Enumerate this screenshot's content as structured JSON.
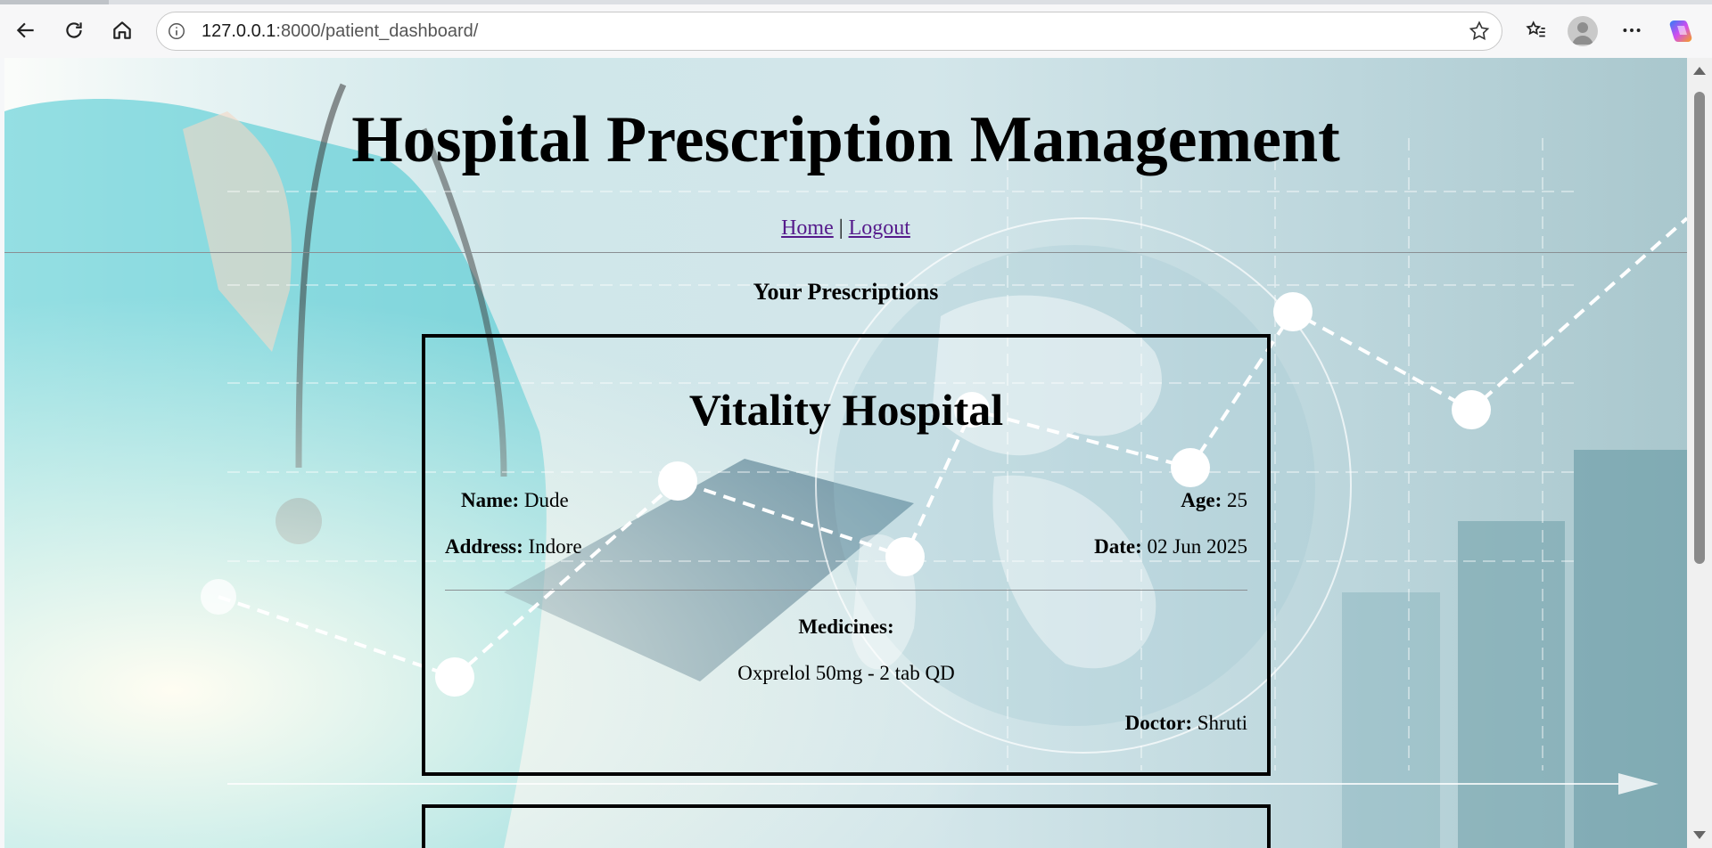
{
  "browser": {
    "url_host": "127.0.0.1",
    "url_path": ":8000/patient_dashboard/"
  },
  "page": {
    "title": "Hospital Prescription Management",
    "nav": {
      "home": "Home",
      "separator": "|",
      "logout": "Logout"
    },
    "section_title": "Your Prescriptions"
  },
  "prescriptions": [
    {
      "hospital": "Vitality Hospital",
      "name_label": "Name:",
      "name": "Dude",
      "age_label": "Age:",
      "age": "25",
      "address_label": "Address:",
      "address": "Indore",
      "date_label": "Date:",
      "date": "02 Jun 2025",
      "medicines_label": "Medicines:",
      "medicines": "Oxprelol 50mg - 2 tab QD",
      "doctor_label": "Doctor:",
      "doctor": "Shruti"
    }
  ],
  "colors": {
    "link": "#551a8b",
    "border": "#000000",
    "background_tint": "#cfe7ea"
  }
}
